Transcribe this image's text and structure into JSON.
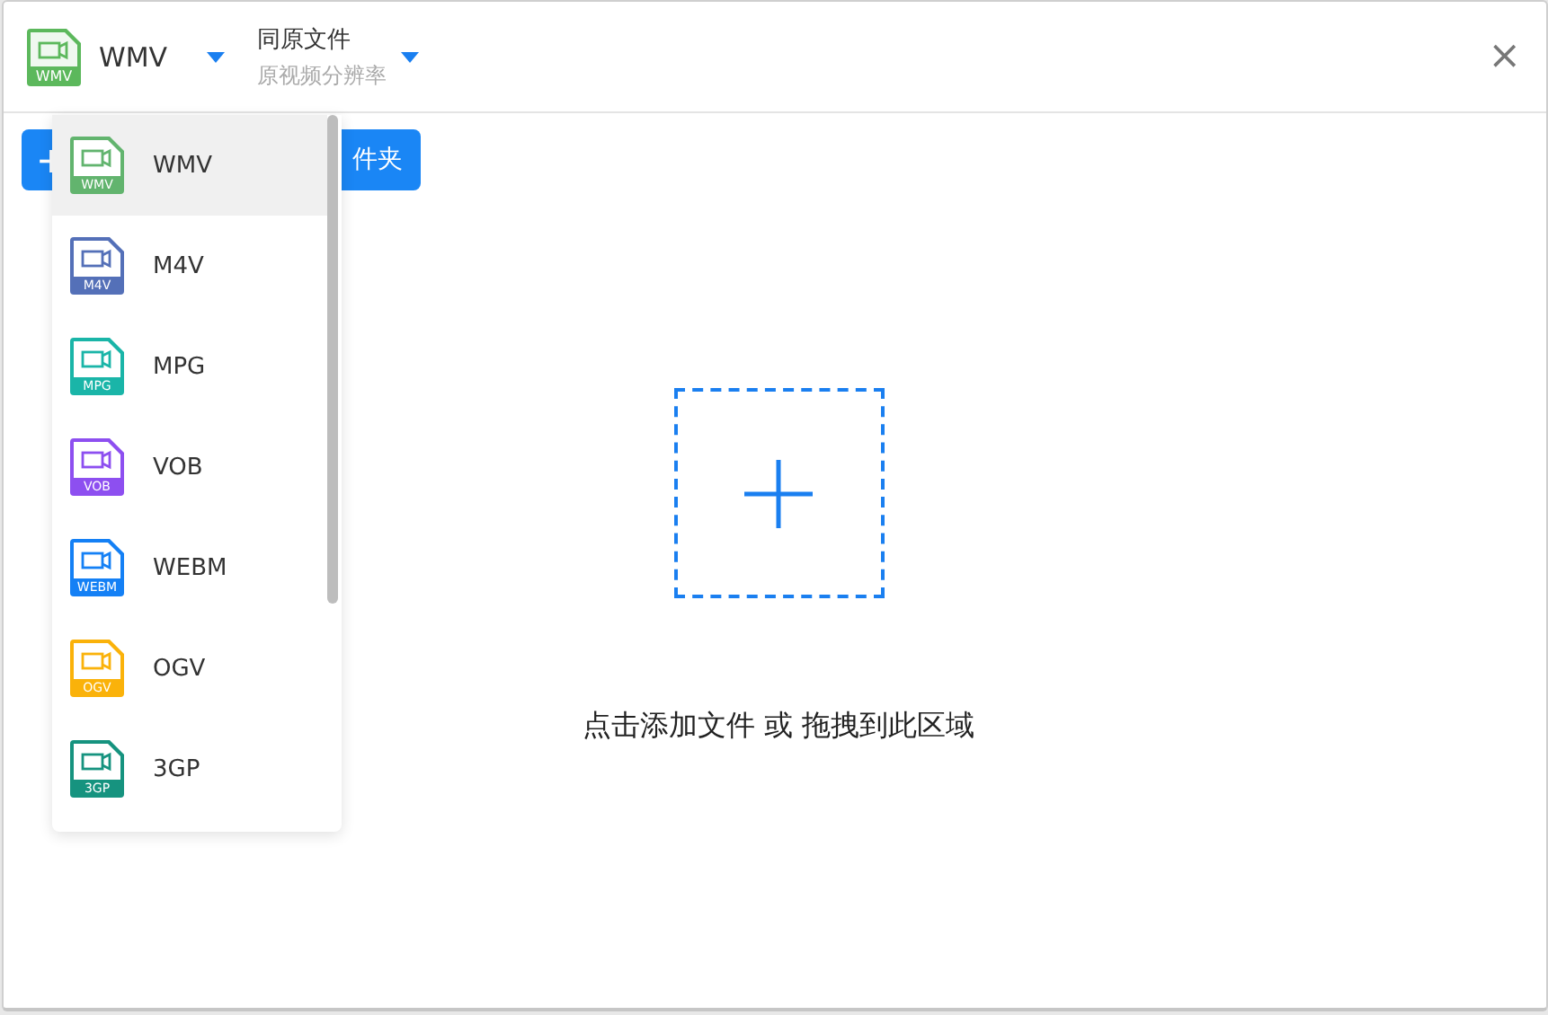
{
  "header": {
    "format": {
      "label": "WMV",
      "badge": "WMV",
      "color": "#5cb85c"
    },
    "resolution": {
      "title": "同原文件",
      "subtitle": "原视频分辨率"
    },
    "close": "×"
  },
  "add_button": {
    "icon": "+",
    "label": "件夹"
  },
  "format_menu": {
    "items": [
      {
        "label": "WMV",
        "badge": "WMV",
        "color": "#62b46e",
        "selected": true
      },
      {
        "label": "M4V",
        "badge": "M4V",
        "color": "#5470b8",
        "selected": false
      },
      {
        "label": "MPG",
        "badge": "MPG",
        "color": "#1ab5a8",
        "selected": false
      },
      {
        "label": "VOB",
        "badge": "VOB",
        "color": "#8d4ff0",
        "selected": false
      },
      {
        "label": "WEBM",
        "badge": "WEBM",
        "color": "#1480f5",
        "selected": false
      },
      {
        "label": "OGV",
        "badge": "OGV",
        "color": "#fab20a",
        "selected": false
      },
      {
        "label": "3GP",
        "badge": "3GP",
        "color": "#16937f",
        "selected": false
      }
    ]
  },
  "drop_zone": {
    "hint": "点击添加文件 或 拖拽到此区域"
  }
}
